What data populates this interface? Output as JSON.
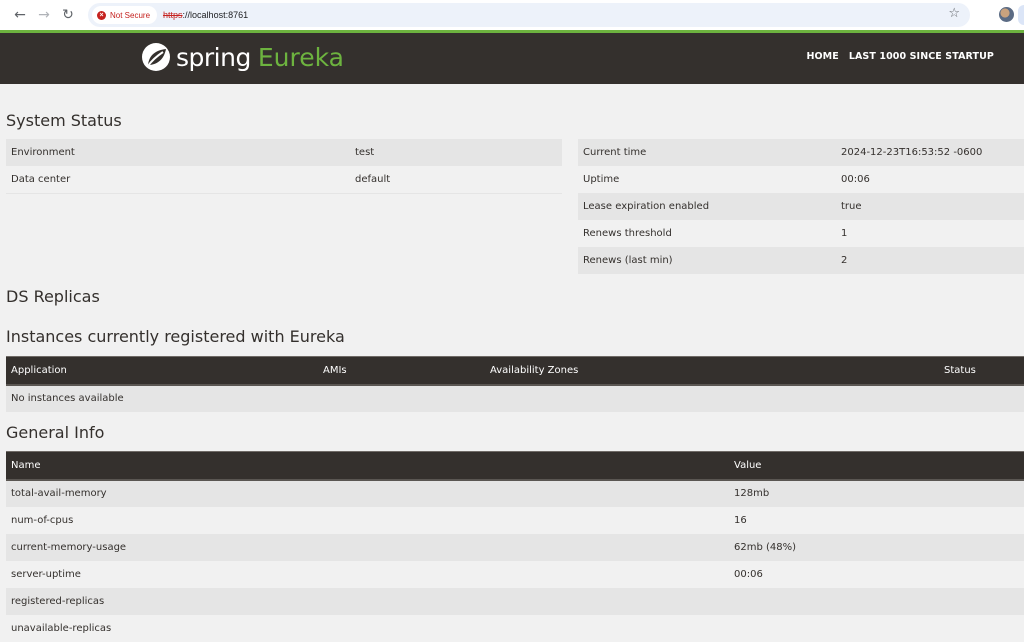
{
  "browser": {
    "security_label": "Not Secure",
    "url_scheme": "https",
    "url_rest": "://localhost:8761"
  },
  "navbar": {
    "brand_spring": "spring",
    "brand_eureka": "Eureka",
    "links": [
      {
        "label": "HOME"
      },
      {
        "label": "LAST 1000 SINCE STARTUP"
      }
    ],
    "accent_color": "#6db33f",
    "background_color": "#34302d"
  },
  "system_status": {
    "title": "System Status",
    "left": [
      {
        "key": "Environment",
        "value": "test"
      },
      {
        "key": "Data center",
        "value": "default"
      }
    ],
    "right": [
      {
        "key": "Current time",
        "value": "2024-12-23T16:53:52 -0600"
      },
      {
        "key": "Uptime",
        "value": "00:06"
      },
      {
        "key": "Lease expiration enabled",
        "value": "true"
      },
      {
        "key": "Renews threshold",
        "value": "1"
      },
      {
        "key": "Renews (last min)",
        "value": "2"
      }
    ]
  },
  "ds_replicas": {
    "title": "DS Replicas"
  },
  "instances": {
    "title": "Instances currently registered with Eureka",
    "columns": [
      "Application",
      "AMIs",
      "Availability Zones",
      "Status"
    ],
    "empty_message": "No instances available"
  },
  "general_info": {
    "title": "General Info",
    "columns": [
      "Name",
      "Value"
    ],
    "rows": [
      {
        "name": "total-avail-memory",
        "value": "128mb"
      },
      {
        "name": "num-of-cpus",
        "value": "16"
      },
      {
        "name": "current-memory-usage",
        "value": "62mb (48%)"
      },
      {
        "name": "server-uptime",
        "value": "00:06"
      },
      {
        "name": "registered-replicas",
        "value": ""
      },
      {
        "name": "unavailable-replicas",
        "value": ""
      }
    ]
  }
}
